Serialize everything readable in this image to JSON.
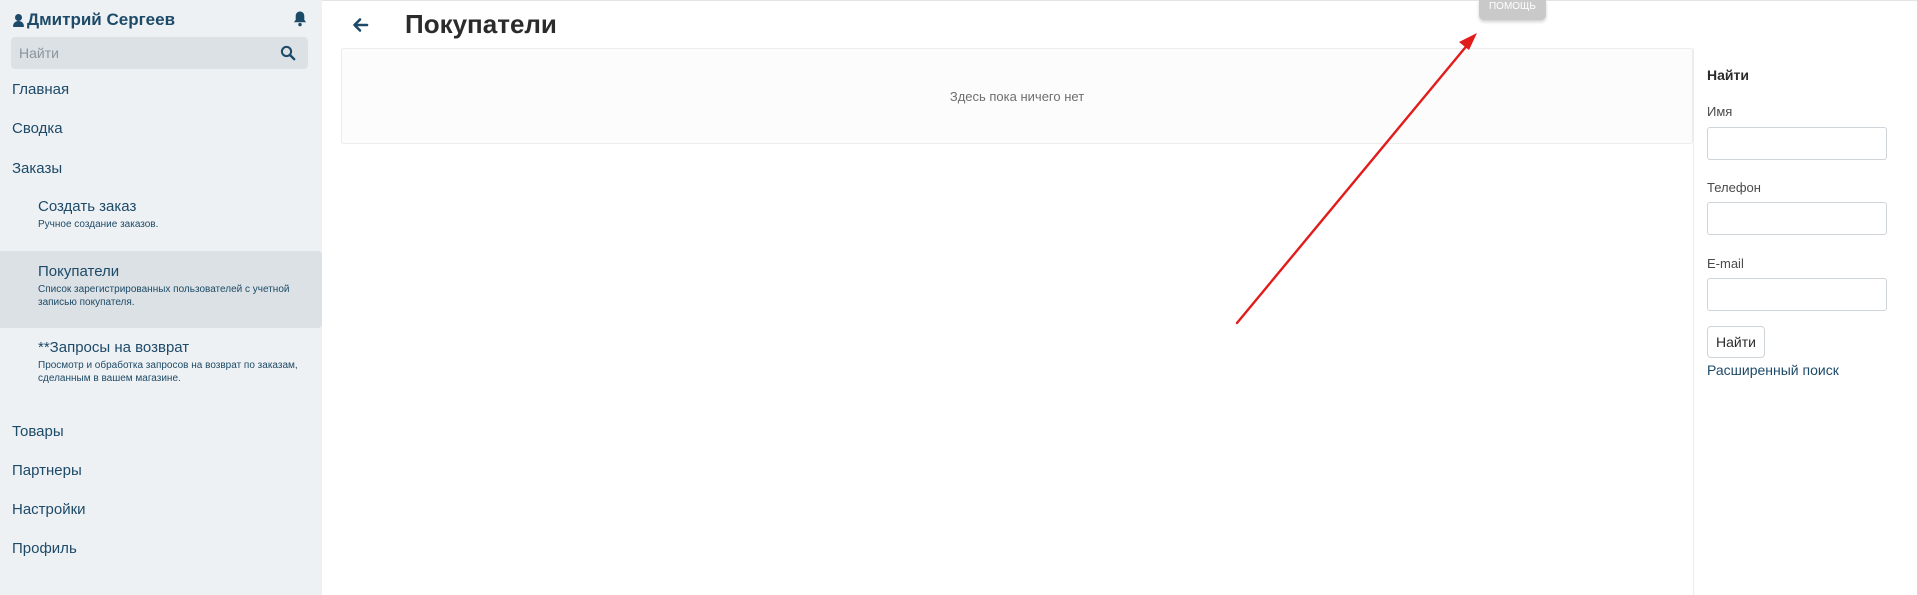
{
  "sidebar": {
    "user_name": "Дмитрий Сергеев",
    "search": {
      "placeholder": "Найти",
      "value": ""
    },
    "nav": {
      "home": "Главная",
      "summary": "Сводка",
      "orders": "Заказы",
      "create_order": {
        "label": "Создать заказ",
        "desc": "Ручное создание заказов."
      },
      "customers": {
        "label": "Покупатели",
        "desc": "Список зарегистрированных пользователей с учетной записью покупателя."
      },
      "returns": {
        "label": "**Запросы на возврат",
        "desc": "Просмотр и обработка запросов на возврат по заказам, сделанным в вашем магазине."
      },
      "products": "Товары",
      "partners": "Партнеры",
      "settings": "Настройки",
      "profile": "Профиль"
    }
  },
  "header": {
    "title": "Покупатели",
    "help_label": "ПОМОЩЬ"
  },
  "main": {
    "empty_text": "Здесь пока ничего нет"
  },
  "filter": {
    "title": "Найти",
    "name_label": "Имя",
    "name_value": "",
    "phone_label": "Телефон",
    "phone_value": "",
    "email_label": "E-mail",
    "email_value": "",
    "find_button": "Найти",
    "advanced_link": "Расширенный поиск"
  },
  "colors": {
    "sidebar_bg": "#eef1f3",
    "accent": "#1d4a68",
    "annotation_arrow": "#e21b1b"
  }
}
